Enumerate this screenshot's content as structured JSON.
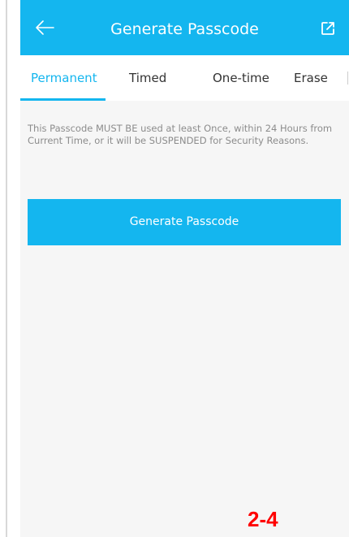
{
  "header": {
    "title": "Generate Passcode",
    "back_icon": "arrow-left-icon",
    "export_icon": "external-link-icon"
  },
  "tabs": [
    {
      "label": "Permanent",
      "active": true
    },
    {
      "label": "Timed",
      "active": false
    },
    {
      "label": "One-time",
      "active": false
    },
    {
      "label": "Erase",
      "active": false
    }
  ],
  "notice": "This Passcode MUST BE used at least Once, within 24 Hours from Current Time, or it will be SUSPENDED for Security Reasons.",
  "generate_button": {
    "label": "Generate Passcode"
  },
  "page_label": "2-4",
  "colors": {
    "accent": "#14b6ef",
    "background": "#f6f6f6",
    "label_red": "#ff0000"
  }
}
